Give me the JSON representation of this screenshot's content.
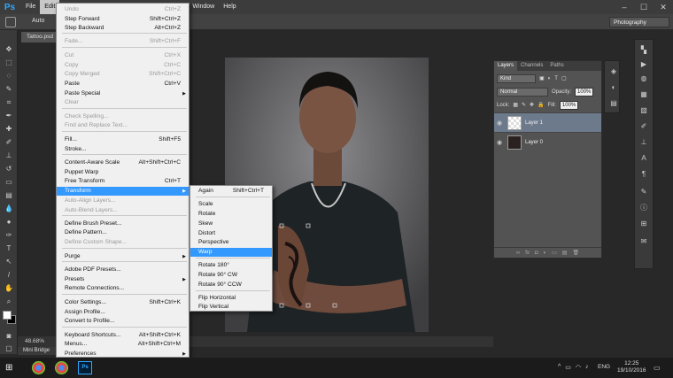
{
  "menubar": {
    "logo": "Ps",
    "items": [
      "File",
      "Edit",
      "Window",
      "Help"
    ],
    "window_controls": [
      "–",
      "☐",
      "✕"
    ]
  },
  "options_bar": {
    "auto_label": "Auto",
    "workspace": "Photography"
  },
  "document": {
    "tab": "Tattoo.psd"
  },
  "status": {
    "zoom": "48.68%",
    "mini_bridge": "Mini Bridge"
  },
  "layers_panel": {
    "tabs": [
      "Layers",
      "Channels",
      "Paths"
    ],
    "filter_kind": "Kind",
    "blend_mode": "Normal",
    "opacity_label": "Opacity:",
    "opacity_value": "100%",
    "lock_label": "Lock:",
    "fill_label": "Fill:",
    "fill_value": "100%",
    "layers": [
      {
        "name": "Layer 1"
      },
      {
        "name": "Layer 0"
      }
    ]
  },
  "edit_menu": {
    "items": [
      {
        "label": "Undo",
        "shortcut": "Ctrl+Z"
      },
      {
        "label": "Step Forward",
        "shortcut": "Shift+Ctrl+Z"
      },
      {
        "label": "Step Backward",
        "shortcut": "Alt+Ctrl+Z"
      },
      {
        "label": "Fade...",
        "shortcut": "Shift+Ctrl+F"
      },
      {
        "label": "Cut",
        "shortcut": "Ctrl+X"
      },
      {
        "label": "Copy",
        "shortcut": "Ctrl+C"
      },
      {
        "label": "Copy Merged",
        "shortcut": "Shift+Ctrl+C"
      },
      {
        "label": "Paste",
        "shortcut": "Ctrl+V"
      },
      {
        "label": "Paste Special",
        "shortcut": ""
      },
      {
        "label": "Clear",
        "shortcut": ""
      },
      {
        "label": "Check Spelling...",
        "shortcut": ""
      },
      {
        "label": "Find and Replace Text...",
        "shortcut": ""
      },
      {
        "label": "Fill...",
        "shortcut": "Shift+F5"
      },
      {
        "label": "Stroke...",
        "shortcut": ""
      },
      {
        "label": "Content-Aware Scale",
        "shortcut": "Alt+Shift+Ctrl+C"
      },
      {
        "label": "Puppet Warp",
        "shortcut": ""
      },
      {
        "label": "Free Transform",
        "shortcut": "Ctrl+T"
      },
      {
        "label": "Transform",
        "shortcut": ""
      },
      {
        "label": "Auto-Align Layers...",
        "shortcut": ""
      },
      {
        "label": "Auto-Blend Layers...",
        "shortcut": ""
      },
      {
        "label": "Define Brush Preset...",
        "shortcut": ""
      },
      {
        "label": "Define Pattern...",
        "shortcut": ""
      },
      {
        "label": "Define Custom Shape...",
        "shortcut": ""
      },
      {
        "label": "Purge",
        "shortcut": ""
      },
      {
        "label": "Adobe PDF Presets...",
        "shortcut": ""
      },
      {
        "label": "Presets",
        "shortcut": ""
      },
      {
        "label": "Remote Connections...",
        "shortcut": ""
      },
      {
        "label": "Color Settings...",
        "shortcut": "Shift+Ctrl+K"
      },
      {
        "label": "Assign Profile...",
        "shortcut": ""
      },
      {
        "label": "Convert to Profile...",
        "shortcut": ""
      },
      {
        "label": "Keyboard Shortcuts...",
        "shortcut": "Alt+Shift+Ctrl+K"
      },
      {
        "label": "Menus...",
        "shortcut": "Alt+Shift+Ctrl+M"
      },
      {
        "label": "Preferences",
        "shortcut": ""
      }
    ]
  },
  "transform_menu": {
    "items": [
      {
        "label": "Again",
        "shortcut": "Shift+Ctrl+T"
      },
      {
        "label": "Scale",
        "shortcut": ""
      },
      {
        "label": "Rotate",
        "shortcut": ""
      },
      {
        "label": "Skew",
        "shortcut": ""
      },
      {
        "label": "Distort",
        "shortcut": ""
      },
      {
        "label": "Perspective",
        "shortcut": ""
      },
      {
        "label": "Warp",
        "shortcut": ""
      },
      {
        "label": "Rotate 180°",
        "shortcut": ""
      },
      {
        "label": "Rotate 90° CW",
        "shortcut": ""
      },
      {
        "label": "Rotate 90° CCW",
        "shortcut": ""
      },
      {
        "label": "Flip Horizontal",
        "shortcut": ""
      },
      {
        "label": "Flip Vertical",
        "shortcut": ""
      }
    ]
  },
  "taskbar": {
    "ps_label": "Ps",
    "language": "ENG",
    "time": "12:25",
    "date": "19/10/2016"
  },
  "colors": {
    "highlight": "#3399ff",
    "ps_blue": "#31a8ff",
    "selected_layer": "#6c7a8c"
  }
}
